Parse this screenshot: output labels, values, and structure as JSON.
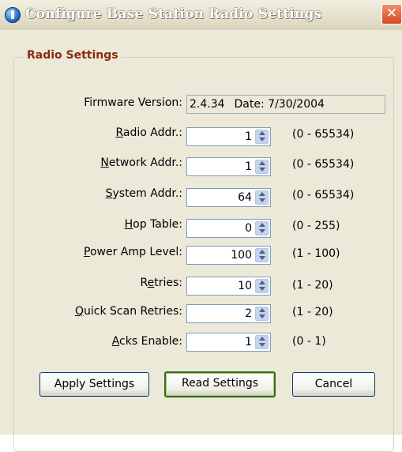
{
  "window": {
    "title": "Configure Base Station Radio Settings",
    "close_glyph": "✕"
  },
  "group": {
    "label": "Radio Settings"
  },
  "firmware": {
    "label": "Firmware Version:",
    "version": "2.4.34",
    "date": "Date: 7/30/2004"
  },
  "fields": [
    {
      "label": "Radio Addr.:",
      "accel": "R",
      "rest": "adio Addr.:",
      "value": "1",
      "range": "(0 - 65534)"
    },
    {
      "label": "Network Addr.:",
      "accel": "N",
      "rest": "etwork Addr.:",
      "value": "1",
      "range": "(0 - 65534)"
    },
    {
      "label": "System Addr.:",
      "accel": "S",
      "rest": "ystem Addr.:",
      "value": "64",
      "range": "(0 - 65534)"
    },
    {
      "label": "Hop Table:",
      "accel": "H",
      "rest": "op Table:",
      "value": "0",
      "range": "(0 - 255)"
    },
    {
      "label": "Power Amp Level:",
      "accel": "P",
      "rest": "ower Amp Level:",
      "value": "100",
      "range": "(1 - 100)"
    },
    {
      "label": "Retries:",
      "pre": "R",
      "accel": "e",
      "rest": "tries:",
      "value": "10",
      "range": "(1 - 20)"
    },
    {
      "label": "Quick Scan Retries:",
      "accel": "Q",
      "rest": "uick Scan Retries:",
      "value": "2",
      "range": "(1 - 20)"
    },
    {
      "label": "Acks Enable:",
      "accel": "A",
      "rest": "cks Enable:",
      "value": "1",
      "range": "(0 - 1)"
    }
  ],
  "buttons": {
    "apply": "Apply Settings",
    "read": "Read Settings",
    "cancel": "Cancel"
  }
}
